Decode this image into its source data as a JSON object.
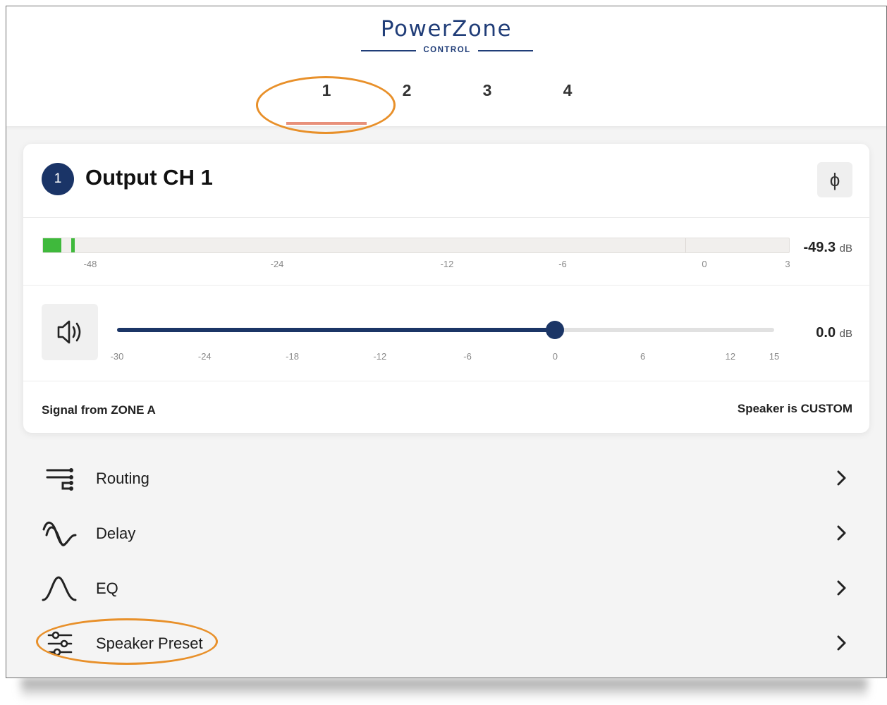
{
  "logo": {
    "title": "PowerZone",
    "subtitle": "CONTROL"
  },
  "tabs": [
    {
      "label": "1",
      "active": true
    },
    {
      "label": "2",
      "active": false
    },
    {
      "label": "3",
      "active": false
    },
    {
      "label": "4",
      "active": false
    }
  ],
  "channel": {
    "number": "1",
    "title": "Output CH 1",
    "phase_icon": "phase-invert-icon"
  },
  "meter": {
    "scale": [
      "-48",
      "-24",
      "-12",
      "-6",
      "0",
      "3"
    ],
    "level_db": -49.3,
    "readout_value": "-49.3",
    "unit": "dB"
  },
  "gain": {
    "scale": [
      "-30",
      "-24",
      "-18",
      "-12",
      "-6",
      "0",
      "6",
      "12",
      "15"
    ],
    "value_db": 0.0,
    "readout_value": "0.0",
    "unit": "dB",
    "mute_icon": "speaker-volume-icon"
  },
  "footer": {
    "signal": "Signal from ZONE A",
    "speaker": "Speaker is CUSTOM"
  },
  "menu": [
    {
      "label": "Routing",
      "icon": "routing-icon"
    },
    {
      "label": "Delay",
      "icon": "delay-wave-icon"
    },
    {
      "label": "EQ",
      "icon": "eq-curve-icon"
    },
    {
      "label": "Speaker Preset",
      "icon": "preset-sliders-icon"
    }
  ],
  "colors": {
    "brand": "#203d78",
    "meter_green": "#3fb93c",
    "slider": "#1b3566",
    "annotation": "#e8902a",
    "tab_underline": "#e8907a"
  }
}
